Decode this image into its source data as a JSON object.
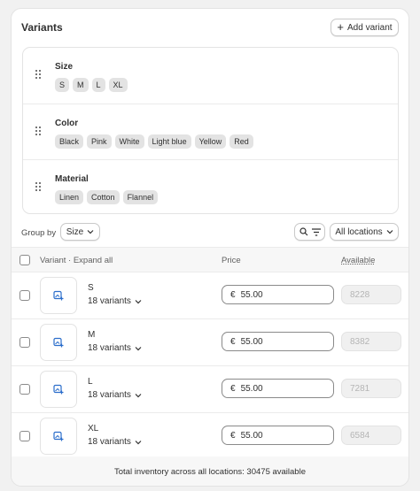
{
  "header": {
    "title": "Variants",
    "add_variant_label": "Add variant"
  },
  "options": [
    {
      "name": "Size",
      "values": [
        "S",
        "M",
        "L",
        "XL"
      ]
    },
    {
      "name": "Color",
      "values": [
        "Black",
        "Pink",
        "White",
        "Light blue",
        "Yellow",
        "Red"
      ]
    },
    {
      "name": "Material",
      "values": [
        "Linen",
        "Cotton",
        "Flannel"
      ]
    }
  ],
  "toolbar": {
    "group_by_label": "Group by",
    "group_by_value": "Size",
    "locations_label": "All locations"
  },
  "table": {
    "col_variant": "Variant · Expand all",
    "col_price": "Price",
    "col_available": "Available",
    "rows": [
      {
        "name": "S",
        "count": "18 variants",
        "currency": "€",
        "price": "55.00",
        "available": "8228"
      },
      {
        "name": "M",
        "count": "18 variants",
        "currency": "€",
        "price": "55.00",
        "available": "8382"
      },
      {
        "name": "L",
        "count": "18 variants",
        "currency": "€",
        "price": "55.00",
        "available": "7281"
      },
      {
        "name": "XL",
        "count": "18 variants",
        "currency": "€",
        "price": "55.00",
        "available": "6584"
      }
    ]
  },
  "footer": {
    "total_text": "Total inventory across all locations: 30475 available"
  },
  "colors": {
    "image_icon": "#2c6ecb",
    "border": "#e3e3e3",
    "header_bg": "#f7f7f7"
  }
}
